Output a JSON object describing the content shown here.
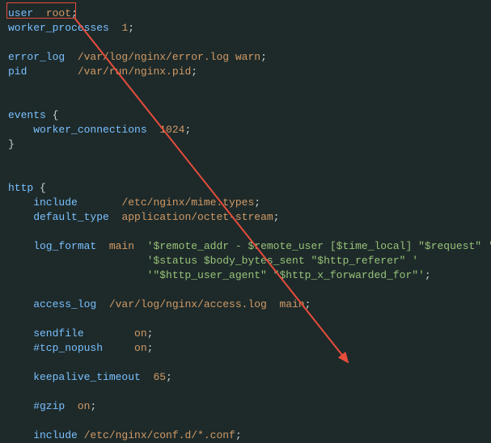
{
  "annotation": {
    "highlight_target": "user root directive",
    "arrow_color": "#e74c3c"
  },
  "config_lines": [
    [
      [
        "kw",
        "user  "
      ],
      [
        "val",
        "root"
      ],
      [
        "punct",
        ";"
      ]
    ],
    [
      [
        "kw",
        "worker_processes  "
      ],
      [
        "val",
        "1"
      ],
      [
        "punct",
        ";"
      ]
    ],
    [],
    [
      [
        "kw",
        "error_log  "
      ],
      [
        "val",
        "/var/log/nginx/error.log warn"
      ],
      [
        "punct",
        ";"
      ]
    ],
    [
      [
        "kw",
        "pid        "
      ],
      [
        "val",
        "/var/run/nginx.pid"
      ],
      [
        "punct",
        ";"
      ]
    ],
    [],
    [],
    [
      [
        "kw",
        "events "
      ],
      [
        "punct",
        "{"
      ]
    ],
    [
      [
        "kw",
        "    worker_connections  "
      ],
      [
        "val",
        "1024"
      ],
      [
        "punct",
        ";"
      ]
    ],
    [
      [
        "punct",
        "}"
      ]
    ],
    [],
    [],
    [
      [
        "kw",
        "http "
      ],
      [
        "punct",
        "{"
      ]
    ],
    [
      [
        "kw",
        "    include       "
      ],
      [
        "val",
        "/etc/nginx/mime.types"
      ],
      [
        "punct",
        ";"
      ]
    ],
    [
      [
        "kw",
        "    default_type  "
      ],
      [
        "val",
        "application/octet-stream"
      ],
      [
        "punct",
        ";"
      ]
    ],
    [],
    [
      [
        "kw",
        "    log_format  "
      ],
      [
        "val",
        "main  "
      ],
      [
        "str",
        "'$remote_addr - $remote_user [$time_local] \"$request\" '"
      ]
    ],
    [
      [
        "str",
        "                      '$status $body_bytes_sent \"$http_referer\" '"
      ]
    ],
    [
      [
        "str",
        "                      '\"$http_user_agent\" \"$http_x_forwarded_for\"'"
      ],
      [
        "punct",
        ";"
      ]
    ],
    [],
    [
      [
        "kw",
        "    access_log  "
      ],
      [
        "val",
        "/var/log/nginx/access.log  main"
      ],
      [
        "punct",
        ";"
      ]
    ],
    [],
    [
      [
        "kw",
        "    sendfile        "
      ],
      [
        "val",
        "on"
      ],
      [
        "punct",
        ";"
      ]
    ],
    [
      [
        "kw",
        "    #tcp_nopush     "
      ],
      [
        "val",
        "on"
      ],
      [
        "punct",
        ";"
      ]
    ],
    [],
    [
      [
        "kw",
        "    keepalive_timeout  "
      ],
      [
        "val",
        "65"
      ],
      [
        "punct",
        ";"
      ]
    ],
    [],
    [
      [
        "kw",
        "    #gzip  "
      ],
      [
        "val",
        "on"
      ],
      [
        "punct",
        ";"
      ]
    ],
    [],
    [
      [
        "kw",
        "    include "
      ],
      [
        "val",
        "/etc/nginx/conf.d/*.conf"
      ],
      [
        "punct",
        ";"
      ]
    ]
  ]
}
